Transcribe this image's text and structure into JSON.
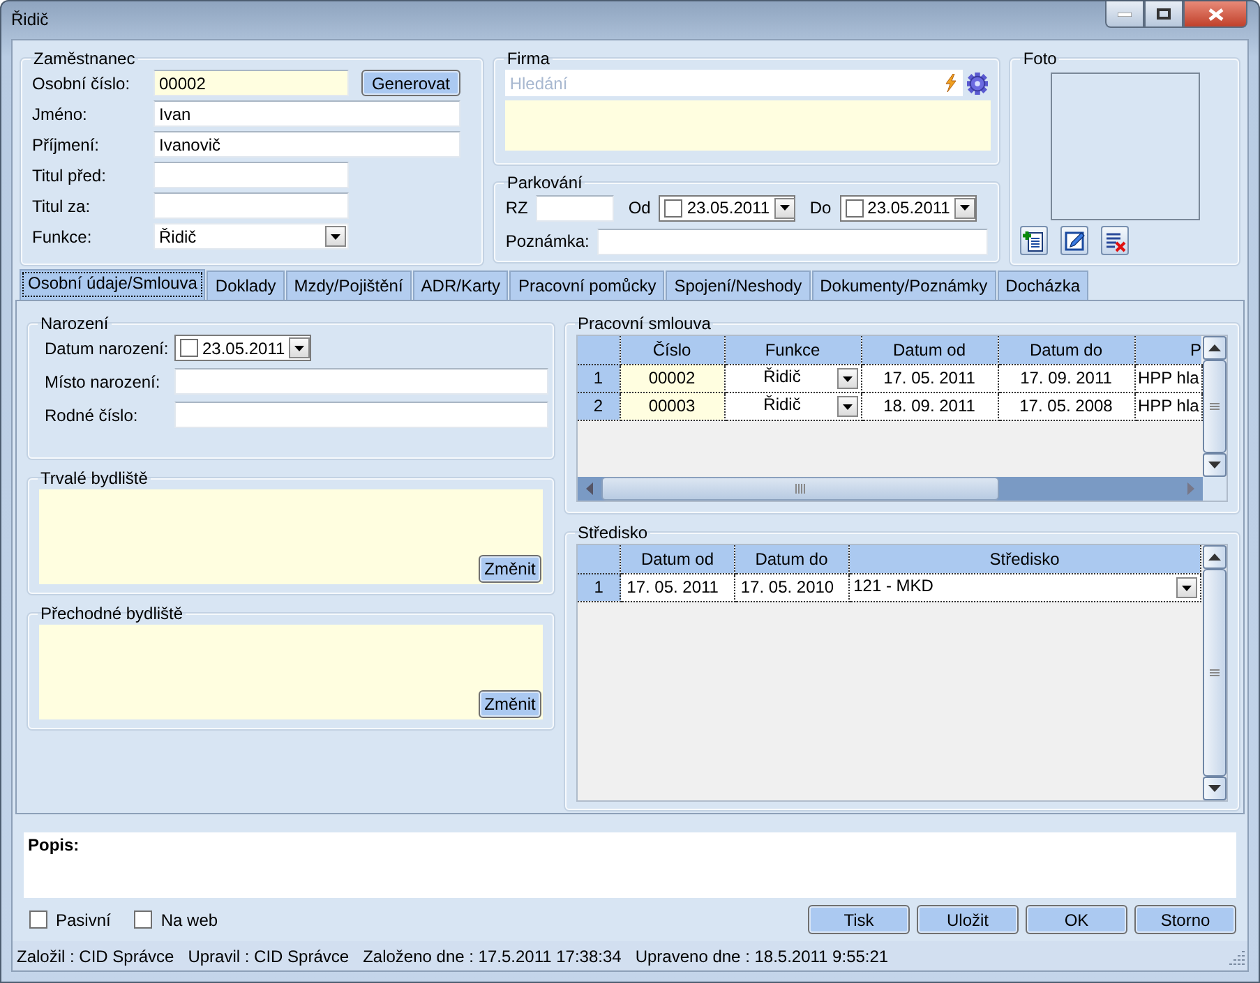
{
  "window": {
    "title": "Řidič"
  },
  "employee": {
    "title": "Zaměstnanec",
    "fields": [
      {
        "label": "Osobní číslo:",
        "kind": "text",
        "value": "00002",
        "highlighted": true,
        "button": "Generovat"
      },
      {
        "label": "Jméno:",
        "kind": "text",
        "value": "Ivan",
        "highlighted": false
      },
      {
        "label": "Příjmení:",
        "kind": "text",
        "value": "Ivanovič",
        "highlighted": false
      },
      {
        "label": "Titul před:",
        "kind": "text",
        "highlighted": false
      },
      {
        "label": "Titul za:",
        "kind": "text",
        "highlighted": false
      },
      {
        "label": "Funkce:",
        "kind": "combo",
        "value": "Řidič",
        "highlighted": false
      }
    ]
  },
  "firm": {
    "title": "Firma",
    "search": {
      "placeholder": "Hledání"
    }
  },
  "parking": {
    "title": "Parkování",
    "rz_label": "RZ",
    "from_label": "Od",
    "from_date": {
      "value": "23.05.2011",
      "checked": false
    },
    "to_label": "Do",
    "to_date": {
      "value": "23.05.2011",
      "checked": false
    },
    "note_label": "Poznámka:"
  },
  "photo": {
    "title": "Foto"
  },
  "tabs": [
    {
      "label": "Osobní údaje/Smlouva",
      "selected": true
    },
    {
      "label": "Doklady",
      "selected": false
    },
    {
      "label": "Mzdy/Pojištění",
      "selected": false
    },
    {
      "label": "ADR/Karty",
      "selected": false
    },
    {
      "label": "Pracovní pomůcky",
      "selected": false
    },
    {
      "label": "Spojení/Neshody",
      "selected": false
    },
    {
      "label": "Dokumenty/Poznámky",
      "selected": false
    },
    {
      "label": "Docházka",
      "selected": false
    }
  ],
  "birth": {
    "title": "Narození",
    "date_label": "Datum narození:",
    "date": {
      "value": "23.05.2011",
      "checked": false
    },
    "place_label": "Místo narození:",
    "id_label": "Rodné číslo:"
  },
  "permanent_address": {
    "title": "Trvalé bydliště",
    "button": "Změnit"
  },
  "temporary_address": {
    "title": "Přechodné bydliště",
    "button": "Změnit"
  },
  "contract": {
    "title": "Pracovní smlouva",
    "columns": [
      {
        "label": "Číslo",
        "kind": "text",
        "highlighted": true
      },
      {
        "label": "Funkce",
        "kind": "combo",
        "highlighted": false
      },
      {
        "label": "Datum od",
        "kind": "text",
        "highlighted": false
      },
      {
        "label": "Datum do",
        "kind": "text",
        "highlighted": false
      },
      {
        "label": "P",
        "kind": "text",
        "highlighted": false
      }
    ],
    "rows": [
      {
        "index": "1",
        "cells": [
          "00002",
          "Řidič",
          "17. 05. 2011",
          "17. 09. 2011",
          "HPP hla"
        ]
      },
      {
        "index": "2",
        "cells": [
          "00003",
          "Řidič",
          "18. 09. 2011",
          "17. 05. 2008",
          "HPP hla"
        ]
      }
    ]
  },
  "centre": {
    "title": "Středisko",
    "columns": [
      {
        "label": "Datum od",
        "kind": "text",
        "highlighted": false
      },
      {
        "label": "Datum do",
        "kind": "text",
        "highlighted": false
      },
      {
        "label": "Středisko",
        "kind": "combo",
        "highlighted": false
      }
    ],
    "rows": [
      {
        "index": "1",
        "cells": [
          "17. 05. 2011",
          "17. 05. 2010",
          "121 - MKD"
        ]
      }
    ]
  },
  "description": {
    "label": "Popis:"
  },
  "checkboxes": [
    {
      "label": "Pasivní",
      "checked": false
    },
    {
      "label": "Na web",
      "checked": false
    }
  ],
  "buttons": [
    "Tisk",
    "Uložit",
    "OK",
    "Storno"
  ],
  "status_bar": [
    "Založil : CID Správce",
    "Upravil : CID Správce",
    "Založeno dne : 17.5.2011 17:38:34",
    "Upraveno dne : 18.5.2011 9:55:21"
  ]
}
